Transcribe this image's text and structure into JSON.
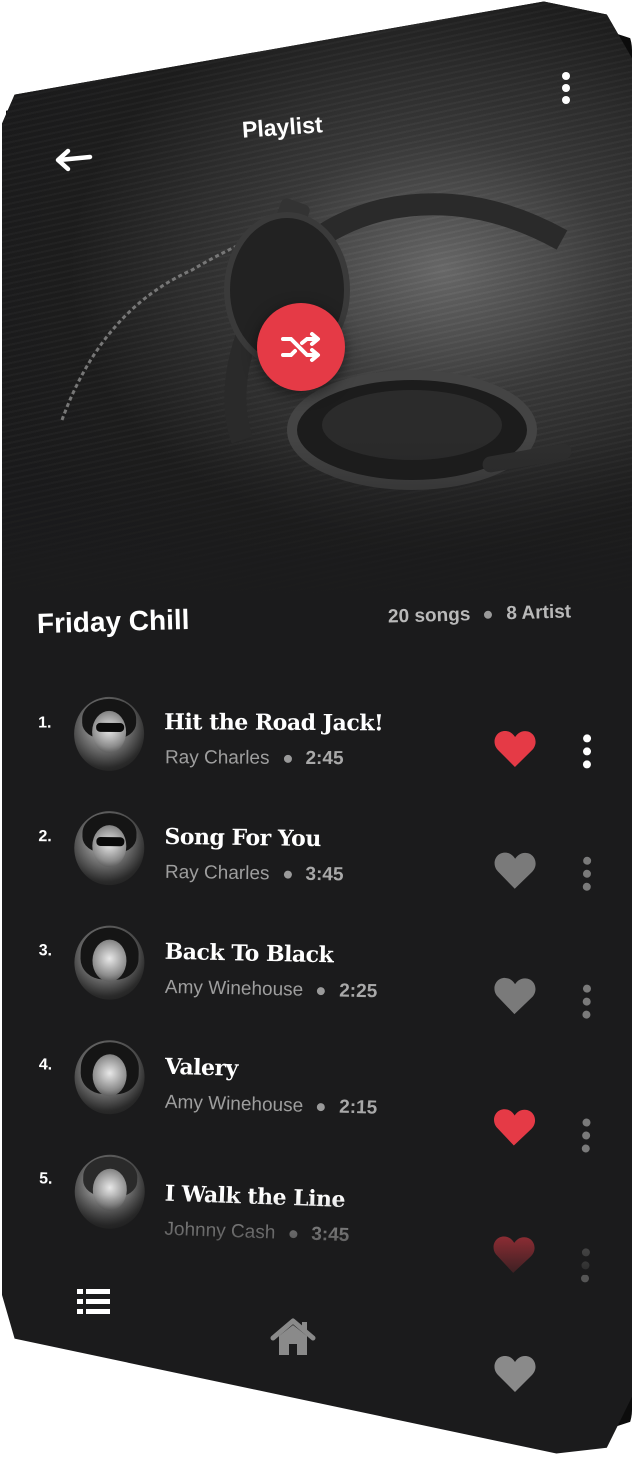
{
  "header": {
    "title": "Playlist",
    "back_icon": "arrow-left-icon",
    "menu_icon": "more-vertical-icon"
  },
  "hero": {
    "shuffle_icon": "shuffle-icon",
    "accent_color": "#e53a46"
  },
  "playlist": {
    "name": "Friday Chill",
    "songs_count": "20 songs",
    "artists_count": "8 Artist"
  },
  "tracks": [
    {
      "number": "1.",
      "title": "Hit the Road Jack!",
      "artist": "Ray Charles",
      "duration": "2:45",
      "liked": true
    },
    {
      "number": "2.",
      "title": "Song For You",
      "artist": "Ray Charles",
      "duration": "3:45",
      "liked": false
    },
    {
      "number": "3.",
      "title": "Back To Black",
      "artist": "Amy Winehouse",
      "duration": "2:25",
      "liked": false
    },
    {
      "number": "4.",
      "title": "Valery",
      "artist": "Amy Winehouse",
      "duration": "2:15",
      "liked": true
    },
    {
      "number": "5.",
      "title": "I Walk the Line",
      "artist": "Johnny Cash",
      "duration": "3:45",
      "liked": true
    }
  ],
  "bottom_nav": {
    "items": [
      "list-icon",
      "home-icon",
      "heart-icon"
    ]
  },
  "colors": {
    "background": "#1b1b1c",
    "liked": "#e53a46",
    "unliked": "#7a7a7a"
  }
}
